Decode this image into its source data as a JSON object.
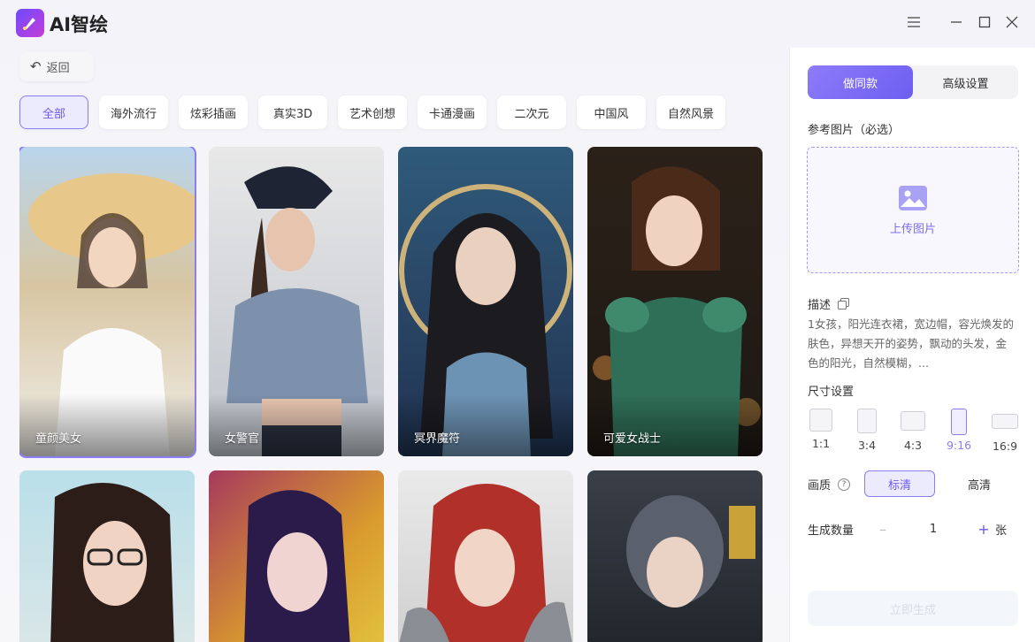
{
  "app": {
    "title": "AI智绘"
  },
  "window": {
    "menu_icon": "menu-icon",
    "min_icon": "minimize-icon",
    "max_icon": "maximize-icon",
    "close_icon": "close-icon"
  },
  "nav": {
    "back_label": "返回"
  },
  "categories": [
    "全部",
    "海外流行",
    "炫彩插画",
    "真实3D",
    "艺术创想",
    "卡通漫画",
    "二次元",
    "中国风",
    "自然风景"
  ],
  "active_category": "全部",
  "gallery": [
    {
      "title": "童颜美女",
      "selected": true
    },
    {
      "title": "女警官",
      "selected": false
    },
    {
      "title": "冥界魔符",
      "selected": false
    },
    {
      "title": "可爱女战士",
      "selected": false
    },
    {
      "title": "",
      "selected": false
    },
    {
      "title": "",
      "selected": false
    },
    {
      "title": "",
      "selected": false
    },
    {
      "title": "",
      "selected": false
    }
  ],
  "panel": {
    "tab_same": "做同款",
    "tab_advanced": "高级设置",
    "ref_label": "参考图片（必选）",
    "upload_label": "上传图片",
    "desc_label": "描述",
    "desc_text": "1女孩，阳光连衣裙，宽边帽，容光焕发的肤色，异想天开的姿势，飘动的头发，金色的阳光，自然模糊，...",
    "size_label": "尺寸设置",
    "sizes": [
      "1:1",
      "3:4",
      "4:3",
      "9:16",
      "16:9"
    ],
    "selected_size": "9:16",
    "quality_label": "画质",
    "quality_options": [
      "标清",
      "高清"
    ],
    "selected_quality": "标清",
    "count_label": "生成数量",
    "count_value": "1",
    "count_unit": "张",
    "minus": "–",
    "plus": "+",
    "generate_label": "立即生成"
  }
}
